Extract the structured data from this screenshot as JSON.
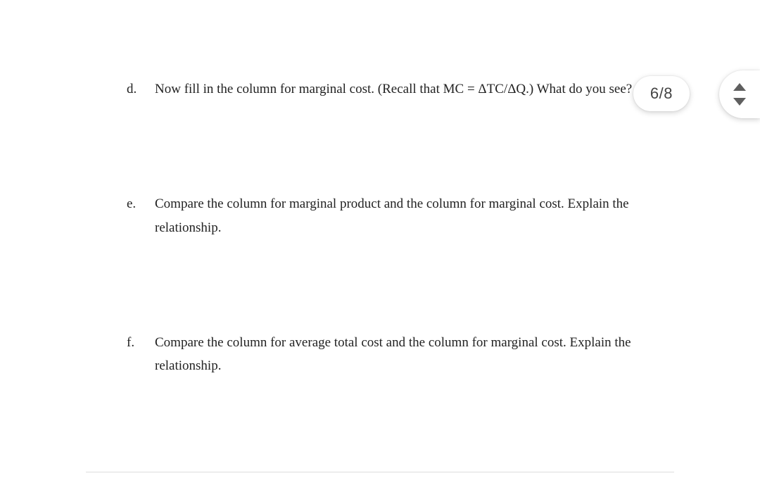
{
  "questions": [
    {
      "marker": "d.",
      "text": "Now fill in the column for marginal cost. (Recall that MC = ΔTC/ΔQ.) What do you see?"
    },
    {
      "marker": "e.",
      "text": "Compare the column for marginal product and the column for marginal cost. Explain the relationship."
    },
    {
      "marker": "f.",
      "text": "Compare the column for average total cost and the column for marginal cost. Explain the relationship."
    }
  ],
  "page_indicator": "6/8"
}
